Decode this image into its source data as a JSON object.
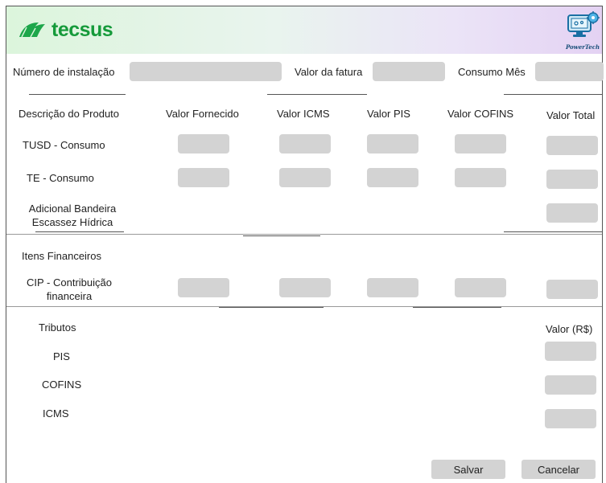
{
  "brand": {
    "name": "tecsus",
    "partner_logo_text": "PowerTech"
  },
  "top_fields": {
    "instalacao_label": "Número de instalação",
    "fatura_label": "Valor da fatura",
    "consumo_label": "Consumo Mês"
  },
  "table": {
    "headers": [
      "Descrição do Produto",
      "Valor Fornecido",
      "Valor ICMS",
      "Valor PIS",
      "Valor COFINS",
      "Valor Total"
    ],
    "rows": {
      "tusd": "TUSD - Consumo",
      "te": "TE - Consumo",
      "bandeira_line1": "Adicional Bandeira",
      "bandeira_line2": "Escassez Hídrica"
    }
  },
  "financeiros": {
    "title": "Itens Financeiros",
    "cip_line1": "CIP - Contribuição",
    "cip_line2": "financeira"
  },
  "tributos": {
    "title": "Tributos",
    "value_header": "Valor (R$)",
    "pis": "PIS",
    "cofins": "COFINS",
    "icms": "ICMS"
  },
  "actions": {
    "save": "Salvar",
    "cancel": "Cancelar"
  },
  "colors": {
    "brand_green": "#159a3a",
    "field_gray": "#d3d3d3"
  }
}
